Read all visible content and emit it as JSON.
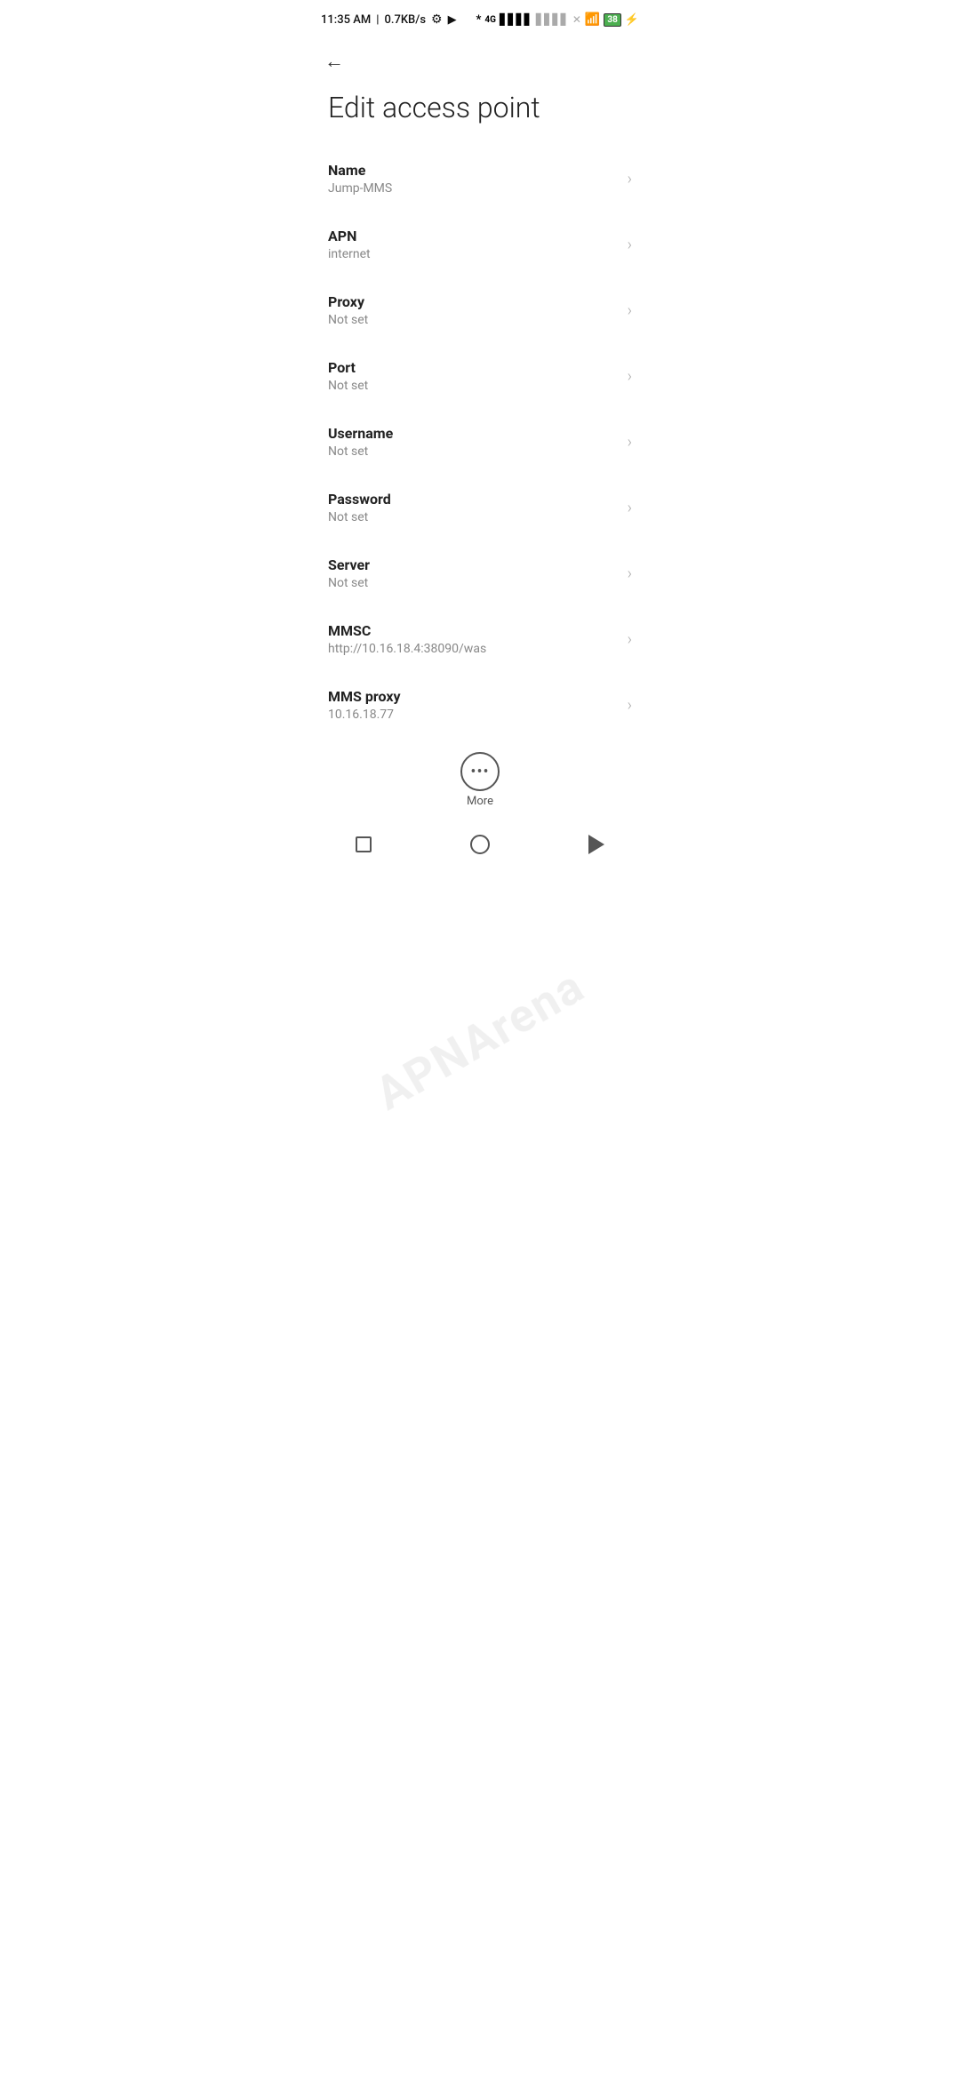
{
  "statusBar": {
    "time": "11:35 AM",
    "speed": "0.7KB/s"
  },
  "header": {
    "backLabel": "←",
    "title": "Edit access point"
  },
  "settings": [
    {
      "label": "Name",
      "value": "Jump-MMS"
    },
    {
      "label": "APN",
      "value": "internet"
    },
    {
      "label": "Proxy",
      "value": "Not set"
    },
    {
      "label": "Port",
      "value": "Not set"
    },
    {
      "label": "Username",
      "value": "Not set"
    },
    {
      "label": "Password",
      "value": "Not set"
    },
    {
      "label": "Server",
      "value": "Not set"
    },
    {
      "label": "MMSC",
      "value": "http://10.16.18.4:38090/was"
    },
    {
      "label": "MMS proxy",
      "value": "10.16.18.77"
    }
  ],
  "more": {
    "label": "More"
  },
  "watermark": "APNArena"
}
